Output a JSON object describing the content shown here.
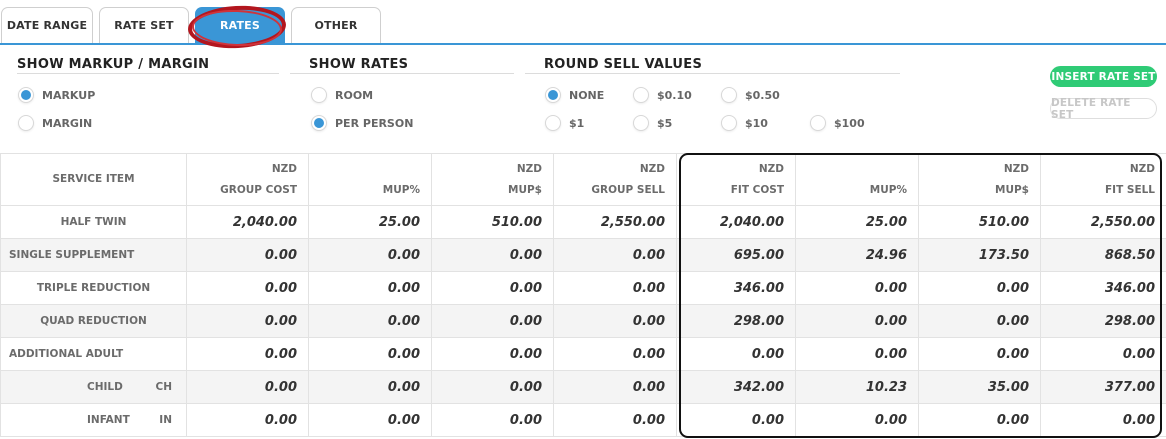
{
  "tabs": [
    {
      "label": "DATE RANGE",
      "active": false
    },
    {
      "label": "RATE SET",
      "active": false
    },
    {
      "label": "RATES",
      "active": true
    },
    {
      "label": "OTHER",
      "active": false
    }
  ],
  "options": {
    "markup_margin": {
      "title": "SHOW MARKUP / MARGIN",
      "items": [
        {
          "label": "MARKUP",
          "selected": true
        },
        {
          "label": "MARGIN",
          "selected": false
        }
      ]
    },
    "show_rates": {
      "title": "SHOW RATES",
      "items": [
        {
          "label": "ROOM",
          "selected": false
        },
        {
          "label": "PER PERSON",
          "selected": true
        }
      ]
    },
    "round_sell": {
      "title": "ROUND SELL VALUES",
      "items": [
        {
          "label": "NONE",
          "selected": true
        },
        {
          "label": "$0.10",
          "selected": false
        },
        {
          "label": "$0.50",
          "selected": false
        },
        {
          "label": "$1",
          "selected": false
        },
        {
          "label": "$5",
          "selected": false
        },
        {
          "label": "$10",
          "selected": false
        },
        {
          "label": "$100",
          "selected": false
        }
      ]
    }
  },
  "buttons": {
    "insert": "INSERT RATE SET",
    "delete": "DELETE RATE SET"
  },
  "colors": {
    "accent": "#3a96d6",
    "insert_button": "#2fcb76",
    "annotation_circle": "#b3161e"
  },
  "table": {
    "headers": [
      {
        "line1": "",
        "line2": "SERVICE ITEM"
      },
      {
        "line1": "NZD",
        "line2": "GROUP COST"
      },
      {
        "line1": "",
        "line2": "MUP%"
      },
      {
        "line1": "NZD",
        "line2": "MUP$"
      },
      {
        "line1": "NZD",
        "line2": "GROUP SELL"
      },
      {
        "line1": "NZD",
        "line2": "FIT COST"
      },
      {
        "line1": "",
        "line2": "MUP%"
      },
      {
        "line1": "NZD",
        "line2": "MUP$"
      },
      {
        "line1": "NZD",
        "line2": "FIT SELL"
      }
    ],
    "rows": [
      {
        "name": "HALF TWIN",
        "code": "",
        "values": [
          "2,040.00",
          "25.00",
          "510.00",
          "2,550.00",
          "2,040.00",
          "25.00",
          "510.00",
          "2,550.00"
        ]
      },
      {
        "name": "SINGLE SUPPLEMENT",
        "code": "",
        "values": [
          "0.00",
          "0.00",
          "0.00",
          "0.00",
          "695.00",
          "24.96",
          "173.50",
          "868.50"
        ]
      },
      {
        "name": "TRIPLE REDUCTION",
        "code": "",
        "values": [
          "0.00",
          "0.00",
          "0.00",
          "0.00",
          "346.00",
          "0.00",
          "0.00",
          "346.00"
        ]
      },
      {
        "name": "QUAD REDUCTION",
        "code": "",
        "values": [
          "0.00",
          "0.00",
          "0.00",
          "0.00",
          "298.00",
          "0.00",
          "0.00",
          "298.00"
        ]
      },
      {
        "name": "ADDITIONAL ADULT",
        "code": "",
        "values": [
          "0.00",
          "0.00",
          "0.00",
          "0.00",
          "0.00",
          "0.00",
          "0.00",
          "0.00"
        ]
      },
      {
        "name": "CHILD",
        "code": "CH",
        "values": [
          "0.00",
          "0.00",
          "0.00",
          "0.00",
          "342.00",
          "10.23",
          "35.00",
          "377.00"
        ]
      },
      {
        "name": "INFANT",
        "code": "IN",
        "values": [
          "0.00",
          "0.00",
          "0.00",
          "0.00",
          "0.00",
          "0.00",
          "0.00",
          "0.00"
        ]
      }
    ]
  }
}
